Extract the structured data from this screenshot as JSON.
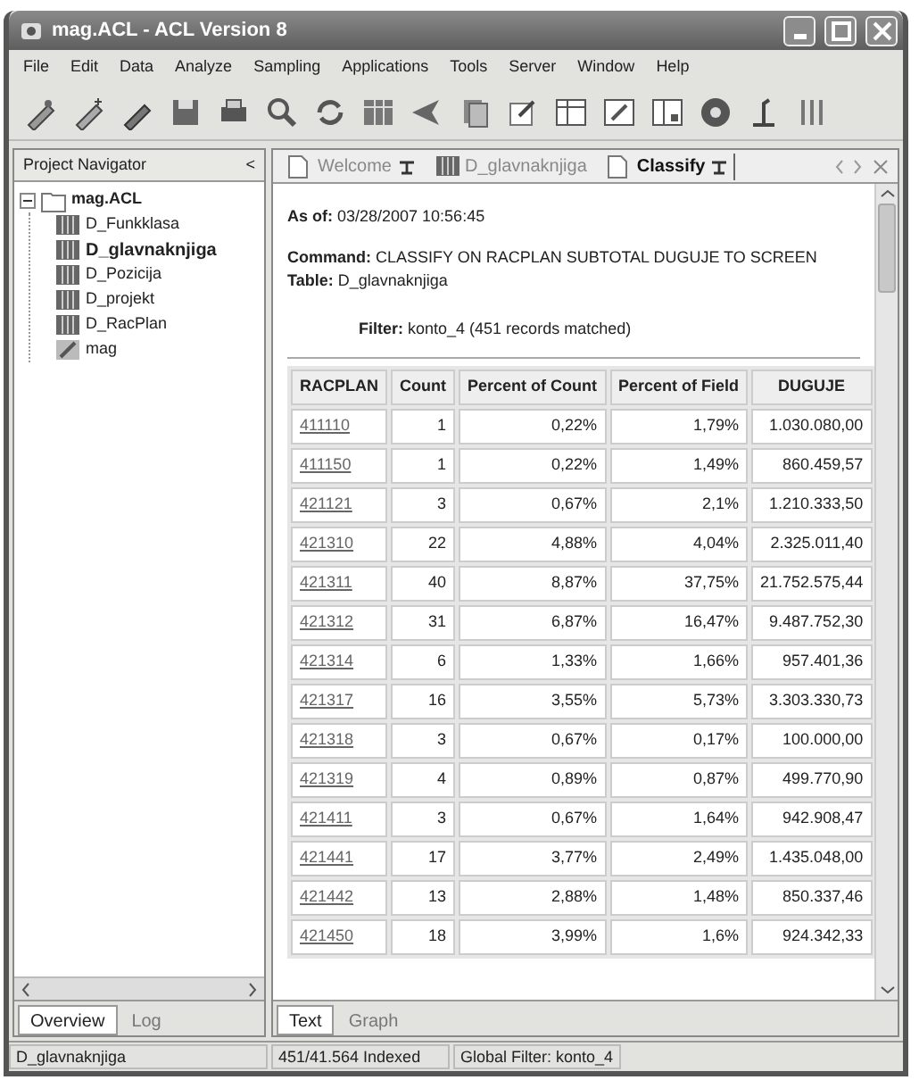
{
  "window": {
    "title": "mag.ACL - ACL Version 8"
  },
  "menu": [
    "File",
    "Edit",
    "Data",
    "Analyze",
    "Sampling",
    "Applications",
    "Tools",
    "Server",
    "Window",
    "Help"
  ],
  "navigator": {
    "title": "Project Navigator",
    "collapse": "<",
    "tree": [
      {
        "label": "mag.ACL",
        "kind": "project",
        "expanded": true,
        "children": [
          {
            "label": "D_Funkklasa",
            "kind": "table",
            "selected": false
          },
          {
            "label": "D_glavnaknjiga",
            "kind": "table",
            "selected": true
          },
          {
            "label": "D_Pozicija",
            "kind": "table",
            "selected": false
          },
          {
            "label": "D_projekt",
            "kind": "table",
            "selected": false
          },
          {
            "label": "D_RacPlan",
            "kind": "table",
            "selected": false
          },
          {
            "label": "mag",
            "kind": "script",
            "selected": false
          }
        ]
      }
    ],
    "tabs": [
      {
        "label": "Overview",
        "selected": true
      },
      {
        "label": "Log",
        "selected": false
      }
    ]
  },
  "doc_tabs": [
    {
      "label": "Welcome",
      "kind": "page",
      "pinned": true,
      "selected": false
    },
    {
      "label": "D_glavnaknjiga",
      "kind": "table",
      "pinned": false,
      "selected": false
    },
    {
      "label": "Classify",
      "kind": "page",
      "pinned": true,
      "selected": true
    }
  ],
  "report": {
    "as_of_label": "As of:",
    "as_of": "03/28/2007 10:56:45",
    "command_label": "Command:",
    "command": "CLASSIFY ON RACPLAN SUBTOTAL DUGUJE TO SCREEN",
    "table_label": "Table:",
    "table": "D_glavnaknjiga",
    "filter_label": "Filter:",
    "filter": "konto_4 (451 records matched)"
  },
  "table": {
    "columns": [
      "RACPLAN",
      "Count",
      "Percent of Count",
      "Percent of Field",
      "DUGUJE"
    ],
    "rows": [
      [
        "411110",
        "1",
        "0,22%",
        "1,79%",
        "1.030.080,00"
      ],
      [
        "411150",
        "1",
        "0,22%",
        "1,49%",
        "860.459,57"
      ],
      [
        "421121",
        "3",
        "0,67%",
        "2,1%",
        "1.210.333,50"
      ],
      [
        "421310",
        "22",
        "4,88%",
        "4,04%",
        "2.325.011,40"
      ],
      [
        "421311",
        "40",
        "8,87%",
        "37,75%",
        "21.752.575,44"
      ],
      [
        "421312",
        "31",
        "6,87%",
        "16,47%",
        "9.487.752,30"
      ],
      [
        "421314",
        "6",
        "1,33%",
        "1,66%",
        "957.401,36"
      ],
      [
        "421317",
        "16",
        "3,55%",
        "5,73%",
        "3.303.330,73"
      ],
      [
        "421318",
        "3",
        "0,67%",
        "0,17%",
        "100.000,00"
      ],
      [
        "421319",
        "4",
        "0,89%",
        "0,87%",
        "499.770,90"
      ],
      [
        "421411",
        "3",
        "0,67%",
        "1,64%",
        "942.908,47"
      ],
      [
        "421441",
        "17",
        "3,77%",
        "2,49%",
        "1.435.048,00"
      ],
      [
        "421442",
        "13",
        "2,88%",
        "1,48%",
        "850.337,46"
      ],
      [
        "421450",
        "18",
        "3,99%",
        "1,6%",
        "924.342,33"
      ]
    ]
  },
  "view_tabs": [
    {
      "label": "Text",
      "selected": true
    },
    {
      "label": "Graph",
      "selected": false
    }
  ],
  "status_bar": [
    "D_glavnaknjiga",
    "451/41.564 Indexed",
    "Global Filter: konto_4"
  ]
}
